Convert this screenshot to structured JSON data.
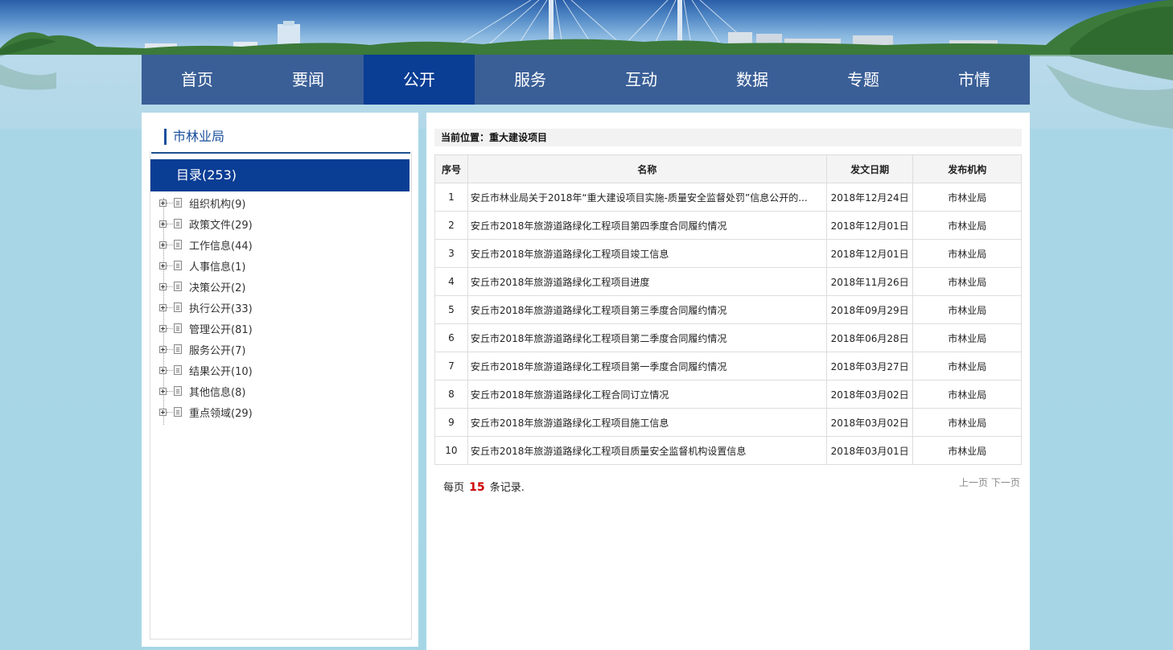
{
  "nav": {
    "items": [
      "首页",
      "要闻",
      "公开",
      "服务",
      "互动",
      "数据",
      "专题",
      "市情"
    ],
    "active_index": 2
  },
  "sidebar": {
    "title": "市林业局",
    "catalog_label": "目录(253)",
    "items": [
      "组织机构(9)",
      "政策文件(29)",
      "工作信息(44)",
      "人事信息(1)",
      "决策公开(2)",
      "执行公开(33)",
      "管理公开(81)",
      "服务公开(7)",
      "结果公开(10)",
      "其他信息(8)",
      "重点领域(29)"
    ]
  },
  "main": {
    "breadcrumb": "当前位置：重大建设项目",
    "table": {
      "headers": [
        "序号",
        "名称",
        "发文日期",
        "发布机构"
      ],
      "rows": [
        [
          "1",
          "安丘市林业局关于2018年“重大建设项目实施-质量安全监督处罚”信息公开的...",
          "2018年12月24日",
          "市林业局"
        ],
        [
          "2",
          "安丘市2018年旅游道路绿化工程项目第四季度合同履约情况",
          "2018年12月01日",
          "市林业局"
        ],
        [
          "3",
          "安丘市2018年旅游道路绿化工程项目竣工信息",
          "2018年12月01日",
          "市林业局"
        ],
        [
          "4",
          "安丘市2018年旅游道路绿化工程项目进度",
          "2018年11月26日",
          "市林业局"
        ],
        [
          "5",
          "安丘市2018年旅游道路绿化工程项目第三季度合同履约情况",
          "2018年09月29日",
          "市林业局"
        ],
        [
          "6",
          "安丘市2018年旅游道路绿化工程项目第二季度合同履约情况",
          "2018年06月28日",
          "市林业局"
        ],
        [
          "7",
          "安丘市2018年旅游道路绿化工程项目第一季度合同履约情况",
          "2018年03月27日",
          "市林业局"
        ],
        [
          "8",
          "安丘市2018年旅游道路绿化工程合同订立情况",
          "2018年03月02日",
          "市林业局"
        ],
        [
          "9",
          "安丘市2018年旅游道路绿化工程项目施工信息",
          "2018年03月02日",
          "市林业局"
        ],
        [
          "10",
          "安丘市2018年旅游道路绿化工程项目质量安全监督机构设置信息",
          "2018年03月01日",
          "市林业局"
        ]
      ]
    },
    "page_size": {
      "prefix": "每页",
      "count": "15",
      "suffix": "条记录."
    },
    "pager": {
      "prev": "上一页",
      "next": "下一页"
    }
  },
  "colors": {
    "nav_bg": "#3a5f97",
    "nav_active": "#0a3d94",
    "accent": "#1a4f9c",
    "highlight_number": "#cc0000"
  }
}
